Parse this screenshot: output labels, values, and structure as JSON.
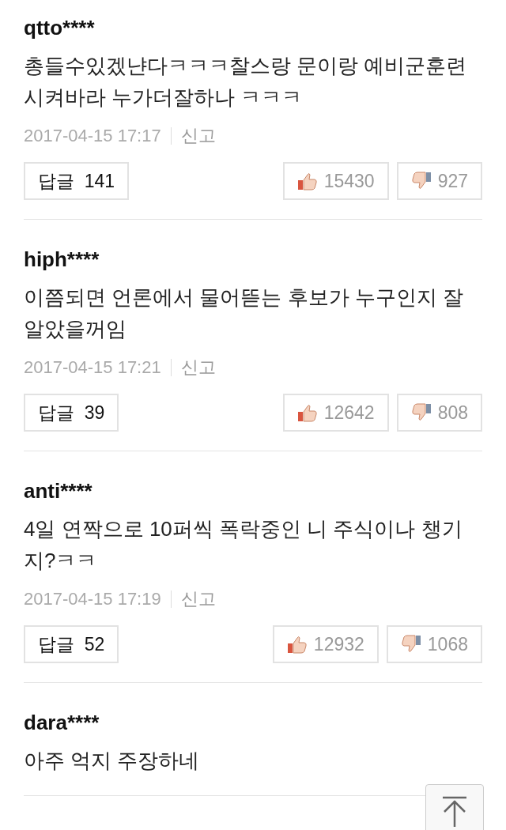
{
  "comments": [
    {
      "user": "qtto****",
      "text": "총들수있겠냔다ㅋㅋㅋ찰스랑 문이랑 예비군훈련 시켜바라 누가더잘하나 ㅋㅋㅋ",
      "date": "2017-04-15 17:17",
      "report": "신고",
      "reply_label": "답글",
      "reply_count": "141",
      "likes": "15430",
      "dislikes": "927"
    },
    {
      "user": "hiph****",
      "text": "이쯤되면 언론에서 물어뜯는 후보가 누구인지 잘 알았을꺼임",
      "date": "2017-04-15 17:21",
      "report": "신고",
      "reply_label": "답글",
      "reply_count": "39",
      "likes": "12642",
      "dislikes": "808"
    },
    {
      "user": "anti****",
      "text": "4일 연짝으로 10퍼씩 폭락중인 니 주식이나 챙기지?ㅋㅋ",
      "date": "2017-04-15 17:19",
      "report": "신고",
      "reply_label": "답글",
      "reply_count": "52",
      "likes": "12932",
      "dislikes": "1068"
    },
    {
      "user": "dara****",
      "text": "아주 억지 주장하네"
    }
  ]
}
